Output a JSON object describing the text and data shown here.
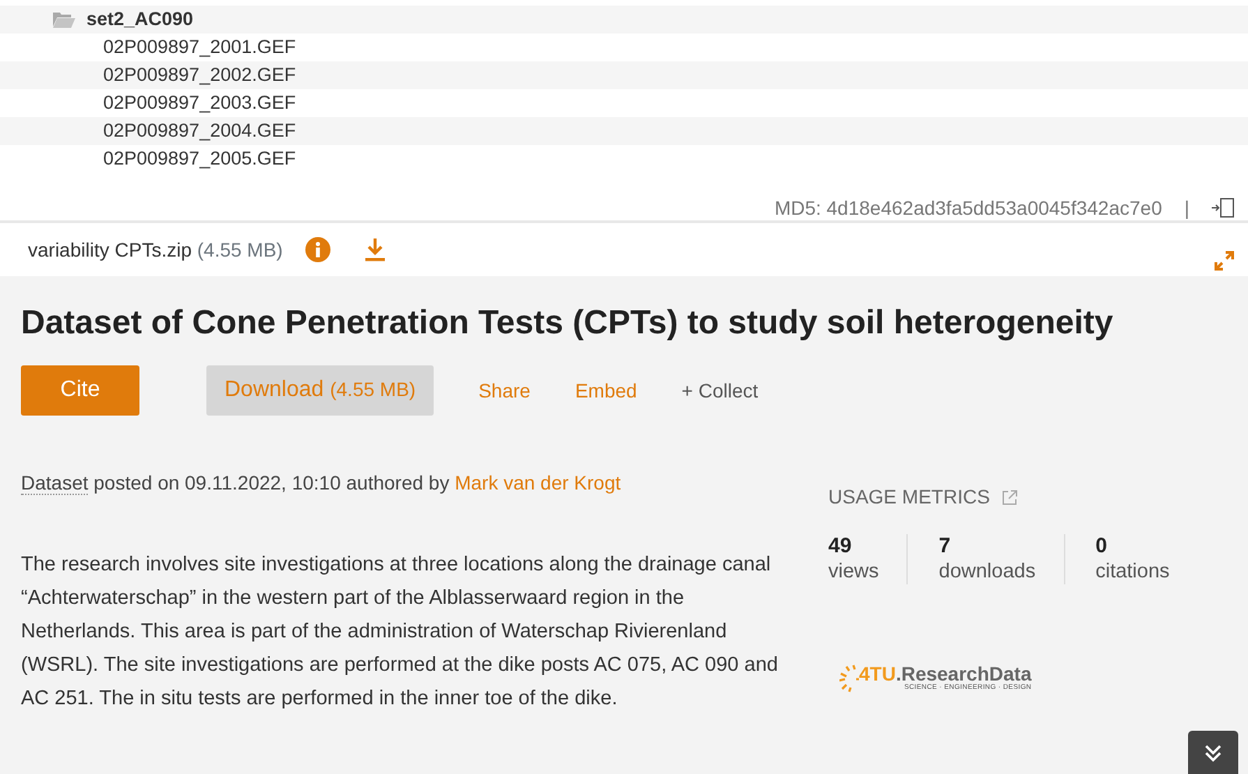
{
  "file_tree": {
    "folder": {
      "name": "set2_AC090",
      "expanded": true
    },
    "files": [
      "02P009897_2001.GEF",
      "02P009897_2002.GEF",
      "02P009897_2003.GEF",
      "02P009897_2004.GEF",
      "02P009897_2005.GEF"
    ]
  },
  "md5": {
    "text": "MD5: 4d18e462ad3fa5dd53a0045f342ac7e0",
    "separator": "|"
  },
  "file_bar": {
    "name": "variability CPTs.zip",
    "size": "(4.55 MB)"
  },
  "title": "Dataset of Cone Penetration Tests (CPTs) to study soil heterogeneity",
  "actions": [
    {
      "kind": "primary",
      "label": "Cite"
    },
    {
      "kind": "download",
      "label": "Download",
      "size": "(4.55 MB)"
    },
    {
      "kind": "link",
      "label": "Share"
    },
    {
      "kind": "link",
      "label": "Embed"
    },
    {
      "kind": "plain",
      "label": "+ Collect"
    }
  ],
  "meta": {
    "type": "Dataset",
    "text": "posted on 09.11.2022, 10:10 authored by",
    "author": "Mark van der Krogt"
  },
  "description": "The research involves site investigations at three locations along the drainage canal “Achterwaterschap” in the western part of the Alblasserwaard region in the Netherlands. This area is part of the administration of Waterschap Rivierenland (WSRL). The site investigations are performed at the dike posts AC 075, AC 090 and AC 251. The in situ tests are performed in the inner toe of the dike.",
  "usage_metrics": {
    "heading": "USAGE METRICS",
    "stats": [
      {
        "value": "49",
        "label": "views"
      },
      {
        "value": "7",
        "label": "downloads"
      },
      {
        "value": "0",
        "label": "citations"
      }
    ]
  },
  "logo": {
    "prefix": "4TU",
    "name": ".ResearchData",
    "tagline": "SCIENCE · ENGINEERING · DESIGN"
  }
}
